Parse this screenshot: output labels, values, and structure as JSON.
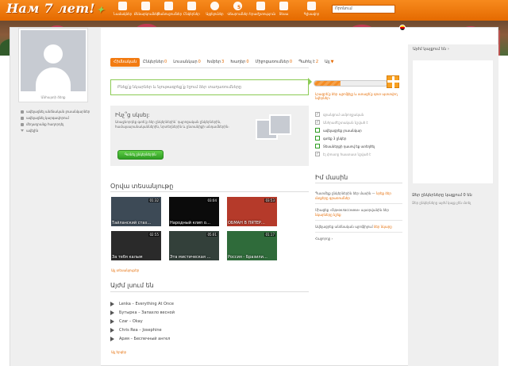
{
  "app": {
    "logo_text": "Нам 7 лет!"
  },
  "nav": [
    {
      "icon": "envelope-icon",
      "label": "Նամակներ"
    },
    {
      "icon": "speech-bubble-icon",
      "label": "Քննարկումներ"
    },
    {
      "icon": "bell-icon",
      "label": "Ծանուցումներ"
    },
    {
      "icon": "people-icon",
      "label": "Ընկերներ"
    },
    {
      "icon": "footprints-icon",
      "label": "Այցելուներ",
      "badge": ""
    },
    {
      "icon": "coins-icon",
      "label": "Վճարումներ",
      "badge": "5"
    },
    {
      "icon": "music-note-icon",
      "label": "Երաժշտություն"
    },
    {
      "icon": "video-icon",
      "label": "Տեսա"
    },
    {
      "icon": "leaf-icon",
      "label": "Գլխավոր"
    }
  ],
  "search": {
    "placeholder": "Որոնում"
  },
  "profile": {
    "caption": "Անհայտի ձեռք",
    "links": [
      {
        "icon": "dot-icon",
        "text": "ավելացնել անձնական լուսանկարներ"
      },
      {
        "icon": "dot-icon",
        "text": "ավելացնել կարգավորում"
      },
      {
        "icon": "dot-icon",
        "text": "մեղադրանք հաղորդել"
      },
      {
        "icon": "arrow-down-icon",
        "text": "ավելին"
      }
    ]
  },
  "tabs": [
    {
      "label": "Հիմնական",
      "count": "",
      "active": true
    },
    {
      "label": "Ընկերներ",
      "count": "0"
    },
    {
      "label": "Լուսանկար",
      "count": "0"
    },
    {
      "label": "Խմբեր",
      "count": "3"
    },
    {
      "label": "Խաղեր",
      "count": "0"
    },
    {
      "label": "Միջոցառումներ",
      "count": "0"
    },
    {
      "label": "Պահել է",
      "count": "2"
    },
    {
      "label": "Այլ",
      "count": "▼"
    }
  ],
  "status": {
    "placeholder": "Բնեք՛ք նկարներ և նյութագրեք՛ք էջում ձեր տաղառումները"
  },
  "friends_box": {
    "title": "Ինչ՞ց սկսել:",
    "text": "Առաջնորդեք գտե՛ք ձեր ընկերներին՝ դպրոցական ընկերներին, համալսարանականներին, նրտեղներին և ընտանիքի անդամներին։",
    "button": "Գտնել ընկերներին"
  },
  "videos_title": "Օրվա տեսանյութը",
  "videos": [
    {
      "duration": "01:32",
      "caption": "Тайланский стах…",
      "color": "#3d4a56"
    },
    {
      "duration": "03:04",
      "caption": "Народный клип о…",
      "color": "#0b0b0b"
    },
    {
      "duration": "03:53",
      "caption": "ОБМАН В ПЯТЕР…",
      "color": "#b53a2a"
    },
    {
      "duration": "02:55",
      "caption": "За тебя калым",
      "color": "#2a2a2a"
    },
    {
      "duration": "05:01",
      "caption": "Эта мистическая …",
      "color": "#33403a"
    },
    {
      "duration": "01:17",
      "caption": "Россия - Бразили…",
      "color": "#2f6b3a"
    }
  ],
  "videos_all": "Այլ տեսանյութեր",
  "music_title": "Այժմ լսում են",
  "music": [
    "Lenka – Everything At Once",
    "Бутырка – Запахло весной",
    "Czar – Okay",
    "Chris Rea – Josephine",
    "Ария – Беспечный ангел"
  ],
  "music_all": "Այլ երգեր",
  "profile_progress": {
    "fraction": 0.36
  },
  "tip": "Լրացրե՛ք ձեր պրոֆիլը և ստացե՛ք գոտ պտտվող նվերներ։",
  "checklist": [
    {
      "text": "գրանցում ամբողջական",
      "done": true
    },
    {
      "text": "Անհրաժեշտական նշված է",
      "done": true
    },
    {
      "text": "ավելացրեք լուսանկար",
      "done": false
    },
    {
      "text": "գտեք 3 ընկեր",
      "done": false
    },
    {
      "text": "Տեսաներքի դասով եք ստեղծել",
      "done": false
    },
    {
      "text": "Էլ փոստը հաստատ նշված է",
      "done": true
    }
  ],
  "news_title": "Իմ մասին",
  "news": [
    {
      "text": "Պատմելք ընկերներին ձեր մասին — ",
      "link": "նրեք ձեր մտքերը գրառումներ"
    },
    {
      "text": "Միացեք «Одноклассники» այսօրվանին ձեր ",
      "link": "նկարները նշեք"
    },
    {
      "text": "Ավելացրեք անձնական պրոֆիլում ",
      "link": "ձեր նկարը"
    }
  ],
  "news_more": "Հաջորդը ›",
  "right": {
    "header": "Այժմ կայքում են ›",
    "online_title": "Ձեր ընկերները կայքում 0 են",
    "online_desc": "Ձեր ընկերները այժմ կայք չեն մտել"
  }
}
